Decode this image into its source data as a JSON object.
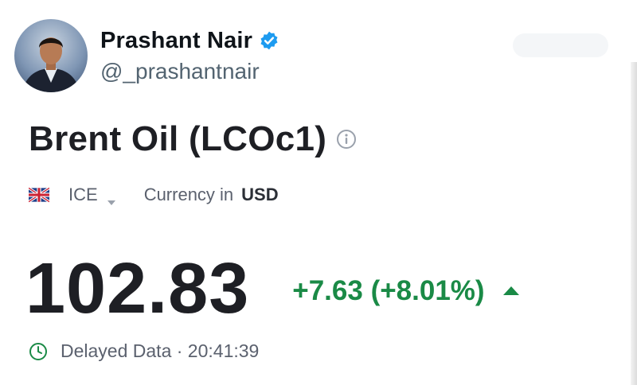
{
  "post": {
    "display_name": "Prashant Nair",
    "handle": "@_prashantnair"
  },
  "quote": {
    "title": "Brent Oil (LCOc1)",
    "exchange": "ICE",
    "currency_label": "Currency in",
    "currency": "USD",
    "price": "102.83",
    "change": "+7.63 (+8.01%)",
    "delay_text": "Delayed Data · 20:41:39"
  },
  "icons": {
    "verified": "verified-badge-icon",
    "info": "info-icon",
    "flag": "uk-flag-icon",
    "caret": "chevron-down-icon",
    "trend": "up-arrow-icon",
    "clock": "clock-icon"
  },
  "colors": {
    "positive": "#1a8a46",
    "verified_blue": "#1d9bf0",
    "muted": "#5b616e"
  }
}
